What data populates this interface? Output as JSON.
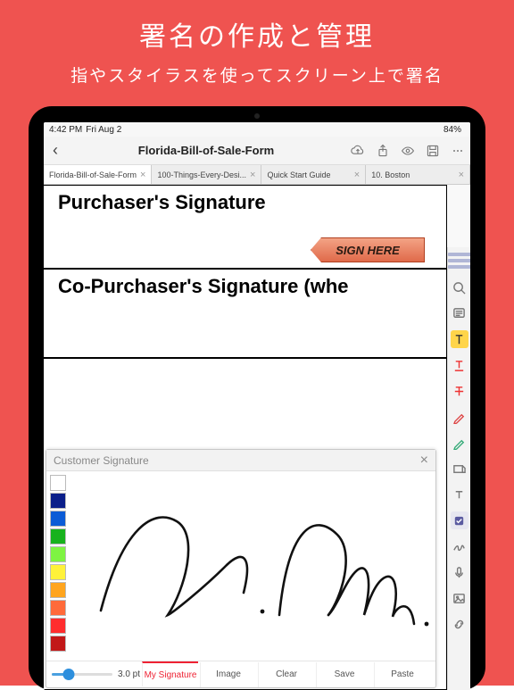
{
  "promo": {
    "title": "署名の作成と管理",
    "subtitle": "指やスタイラスを使ってスクリーン上で署名"
  },
  "status": {
    "time": "4:42 PM",
    "date": "Fri Aug 2",
    "battery": "84%"
  },
  "header": {
    "doc_title": "Florida-Bill-of-Sale-Form"
  },
  "tabs": [
    {
      "label": "Florida-Bill-of-Sale-Form",
      "active": true
    },
    {
      "label": "100-Things-Every-Desi...",
      "active": false
    },
    {
      "label": "Quick Start Guide",
      "active": false
    },
    {
      "label": "10. Boston",
      "active": false
    }
  ],
  "document": {
    "row1_label": "Purchaser's Signature",
    "sign_here": "SIGN HERE",
    "row2_label": "Co-Purchaser's Signature (whe"
  },
  "sig_panel": {
    "title": "Customer Signature",
    "stroke_label": "3.0 pt",
    "palette": [
      "#ffffff",
      "#0b1f8a",
      "#0b5bd6",
      "#17b21d",
      "#7ef442",
      "#fff23a",
      "#ffa51e",
      "#ff6a3a",
      "#ff2d2e",
      "#c21818"
    ],
    "buttons": {
      "my_signature": "My Signature",
      "image": "Image",
      "clear": "Clear",
      "save": "Save",
      "paste": "Paste"
    }
  },
  "rail": {
    "items": [
      "toggle",
      "search",
      "note",
      "highlight",
      "underline",
      "strikeout",
      "pencil",
      "pen",
      "shape",
      "textbox",
      "stamp",
      "signature",
      "mic",
      "image",
      "link"
    ]
  }
}
